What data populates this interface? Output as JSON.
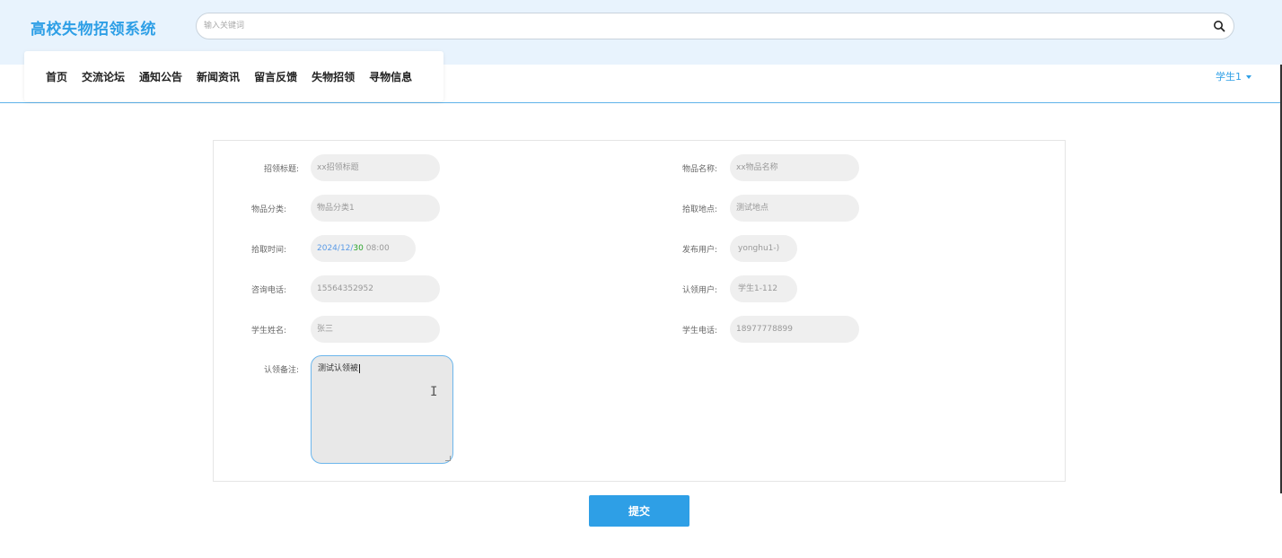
{
  "header": {
    "logo": "高校失物招领系统",
    "search_placeholder": "输入关键词",
    "user_label": "学生1"
  },
  "nav": {
    "items": [
      "首页",
      "交流论坛",
      "通知公告",
      "新闻资讯",
      "留言反馈",
      "失物招领",
      "寻物信息"
    ]
  },
  "form": {
    "left": [
      {
        "label": "招领标题:",
        "value": "xx招领标题"
      },
      {
        "label": "物品分类:",
        "value": "物品分类1"
      },
      {
        "label": "拾取时间:",
        "value_year": "2024/",
        "value_month": "12/",
        "value_day": "30",
        "value_time": " 08:00"
      },
      {
        "label": "咨询电话:",
        "value": "15564352952"
      },
      {
        "label": "学生姓名:",
        "value": "张三"
      }
    ],
    "right": [
      {
        "label": "物品名称:",
        "value": "xx物品名称"
      },
      {
        "label": "拾取地点:",
        "value": "测试地点"
      },
      {
        "label": "发布用户:",
        "value": "yonghu1-)"
      },
      {
        "label": "认领用户:",
        "value": "学生1-112"
      },
      {
        "label": "学生电话:",
        "value": "18977778899"
      }
    ],
    "remark_label": "认领备注:",
    "remark_value": "测试认领被",
    "submit_label": "提交"
  },
  "colors": {
    "accent": "#2e9fe6",
    "header_bg": "#e8f3fd",
    "input_bg": "#efefef"
  }
}
